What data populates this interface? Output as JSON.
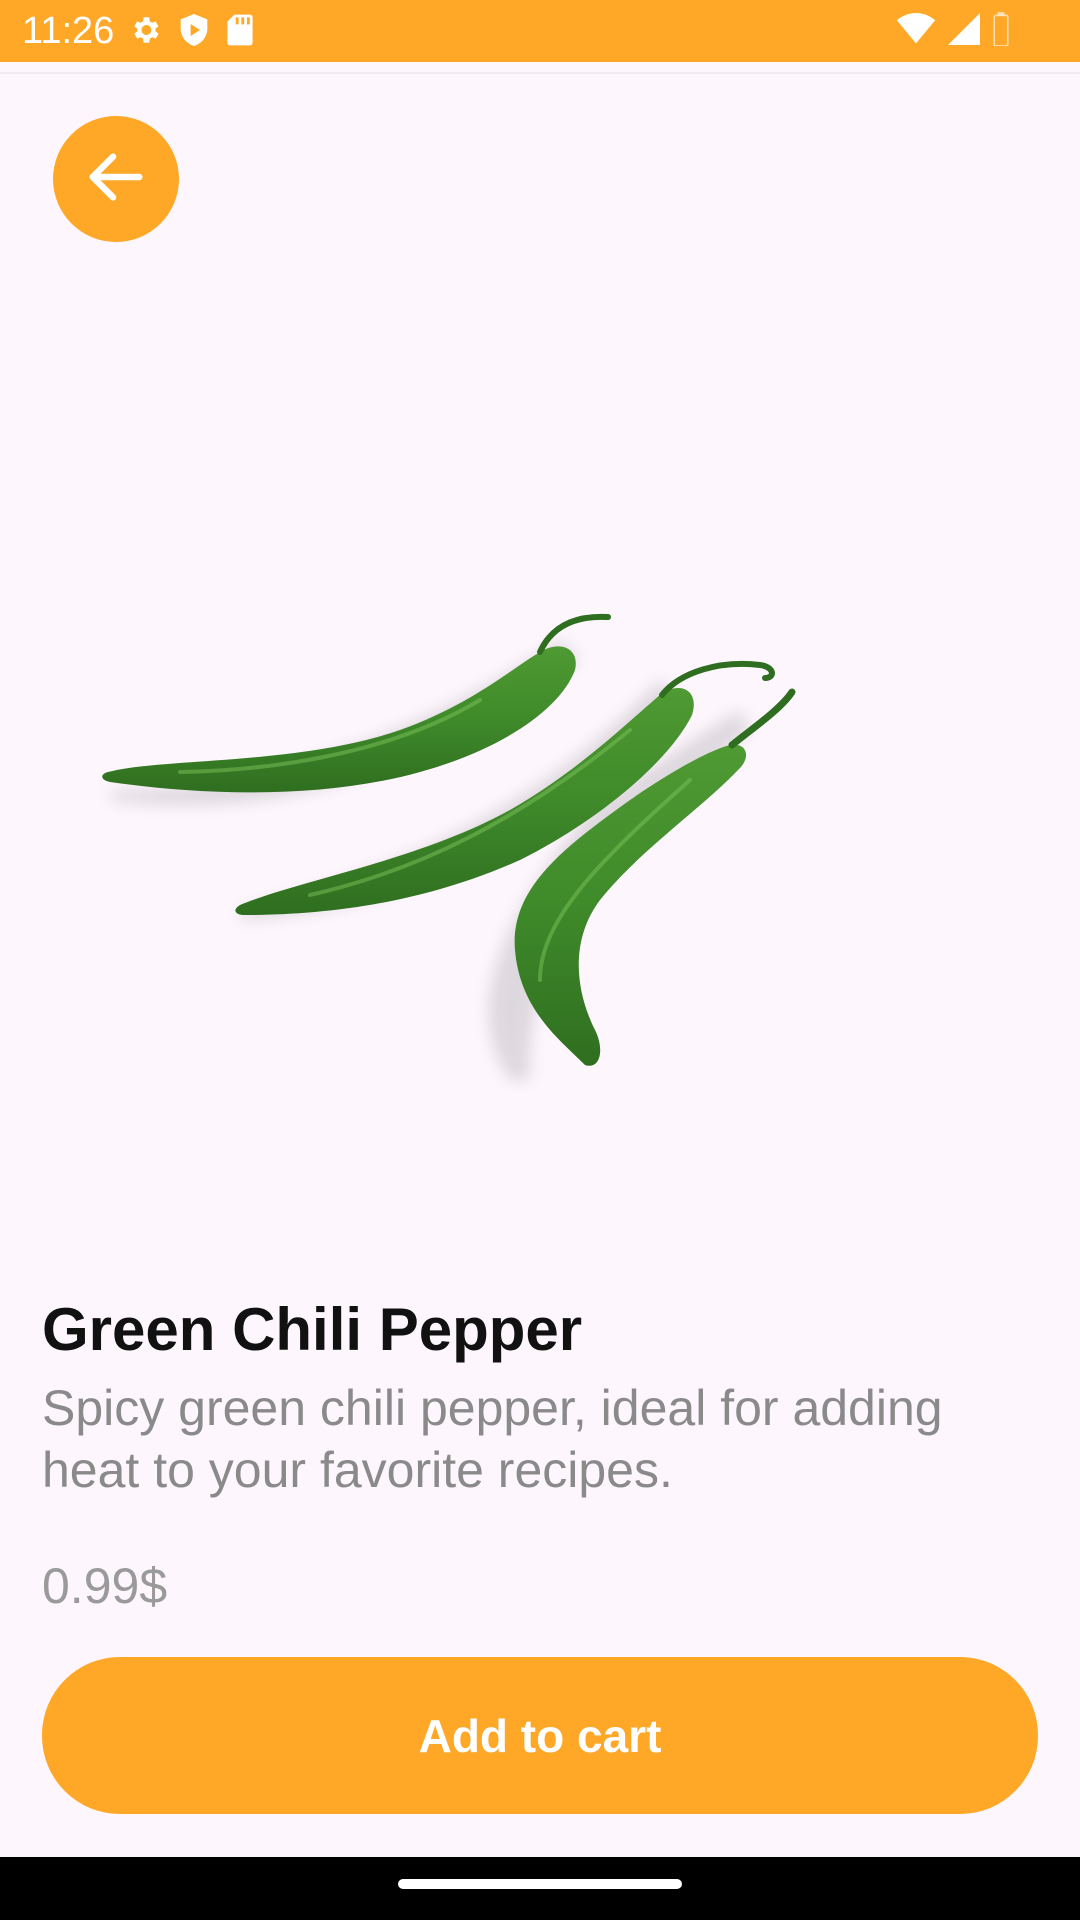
{
  "status_bar": {
    "time": "11:26",
    "icons_left": [
      "gear-icon",
      "shield-play-icon",
      "sd-card-icon"
    ],
    "icons_right": [
      "wifi-icon",
      "signal-icon",
      "battery-icon"
    ],
    "color": "#ffa726"
  },
  "header": {
    "back_icon": "arrow-left-icon"
  },
  "product": {
    "name": "Green Chili Pepper",
    "description": "Spicy green chili pepper, ideal for adding heat to your favorite recipes.",
    "price": "0.99$"
  },
  "actions": {
    "add_to_cart_label": "Add to cart"
  },
  "theme": {
    "accent": "#ffa726",
    "background": "#fdf7fd",
    "pepper_green": "#3f8a2a"
  }
}
